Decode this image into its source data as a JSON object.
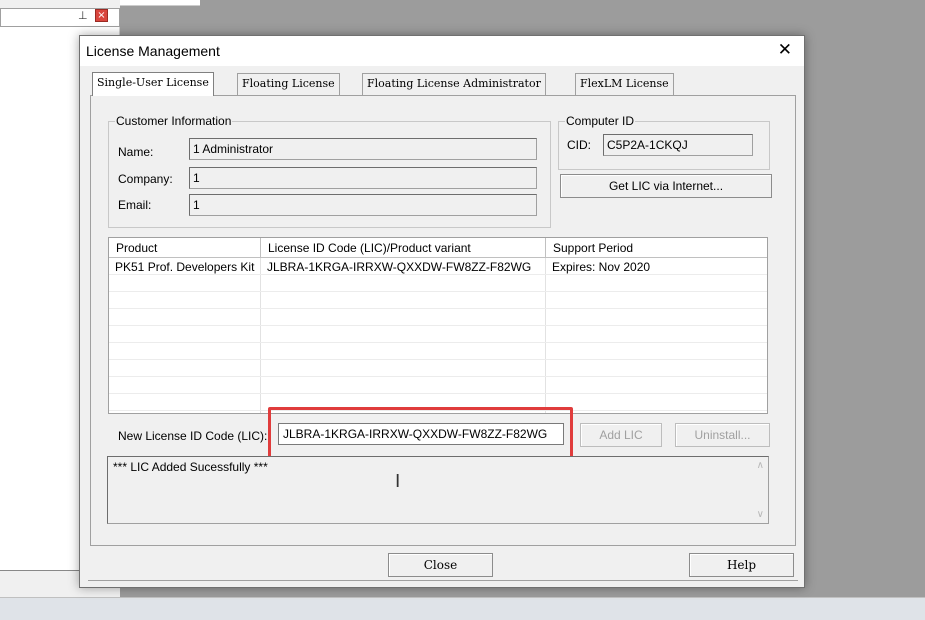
{
  "background_app": {
    "pin_icon": "pin-icon",
    "close_icon": "close-icon"
  },
  "dialog": {
    "title": "License Management",
    "close_glyph": "✕",
    "tabs": [
      {
        "label": "Single-User License",
        "active": true
      },
      {
        "label": "Floating License",
        "active": false
      },
      {
        "label": "Floating License Administrator",
        "active": false
      },
      {
        "label": "FlexLM License",
        "active": false
      }
    ],
    "customer": {
      "group_label": "Customer Information",
      "name_label": "Name:",
      "name_value": "1 Administrator",
      "company_label": "Company:",
      "company_value": "1",
      "email_label": "Email:",
      "email_value": "1"
    },
    "computer": {
      "group_label": "Computer ID",
      "cid_label": "CID:",
      "cid_value": "C5P2A-1CKQJ",
      "get_lic_button": "Get LIC via Internet..."
    },
    "product_table": {
      "columns": [
        "Product",
        "License ID Code (LIC)/Product variant",
        "Support Period"
      ],
      "rows": [
        [
          "PK51 Prof. Developers Kit",
          "JLBRA-1KRGA-IRRXW-QXXDW-FW8ZZ-F82WG",
          "Expires: Nov 2020"
        ]
      ]
    },
    "new_lic": {
      "label": "New License ID Code (LIC):",
      "value": "JLBRA-1KRGA-IRRXW-QXXDW-FW8ZZ-F82WG",
      "add_button": "Add LIC",
      "uninstall_button": "Uninstall..."
    },
    "message": "*** LIC Added Sucessfully ***",
    "close_button": "Close",
    "help_button": "Help"
  },
  "colors": {
    "highlight": "#e03c3c",
    "dialog_bg": "#f0f0f0"
  }
}
